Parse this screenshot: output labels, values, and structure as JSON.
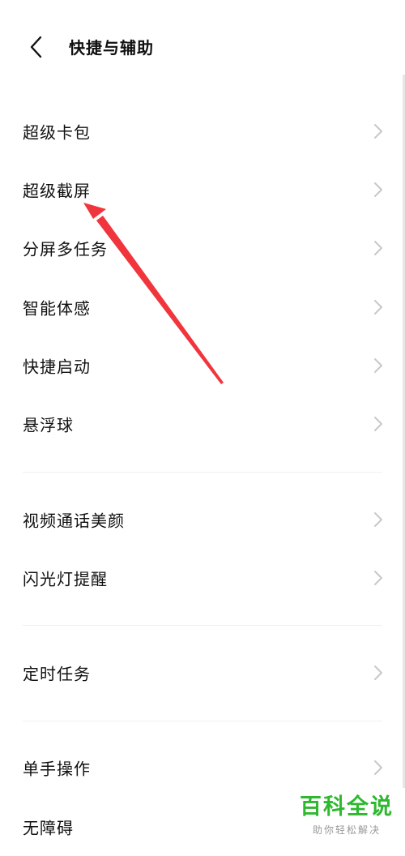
{
  "header": {
    "title": "快捷与辅助"
  },
  "groups": [
    {
      "items": [
        "超级卡包",
        "超级截屏",
        "分屏多任务",
        "智能体感",
        "快捷启动",
        "悬浮球"
      ]
    },
    {
      "items": [
        "视频通话美颜",
        "闪光灯提醒"
      ]
    },
    {
      "items": [
        "定时任务"
      ]
    },
    {
      "items": [
        "单手操作",
        "无障碍"
      ]
    }
  ],
  "watermark": {
    "title": "百科全说",
    "subtitle": "助你轻松解决"
  },
  "colors": {
    "arrow": "#f0353d",
    "watermark": "#2eb82e",
    "chevron": "#c8c8c8"
  },
  "icons": {
    "back": "chevron-left-icon",
    "row": "chevron-right-icon",
    "annotation": "red-arrow"
  }
}
